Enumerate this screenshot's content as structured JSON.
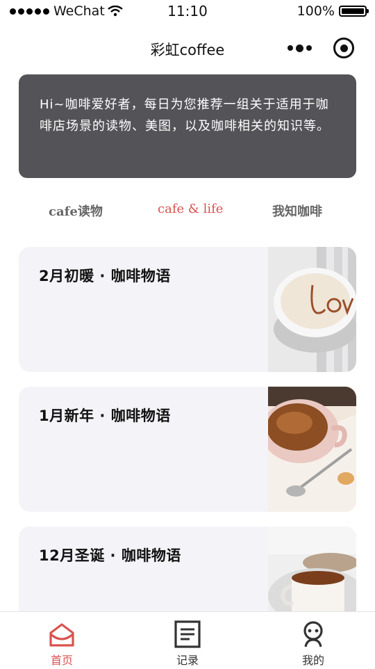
{
  "status_bar": {
    "carrier": "WeChat",
    "time": "11:10",
    "battery": "100%"
  },
  "navbar": {
    "title": "彩虹coffee"
  },
  "banner": {
    "text": "Hi~咖啡爱好者，每日为您推荐一组关于适用于咖啡店场景的读物、美图，以及咖啡相关的知识等。"
  },
  "tabs": [
    {
      "label": "cafe读物",
      "active": false
    },
    {
      "label": "cafe & life",
      "active": true
    },
    {
      "label": "我知咖啡",
      "active": false
    }
  ],
  "articles": [
    {
      "title": "2月初暖 · 咖啡物语",
      "image": "love-latte-art-cup"
    },
    {
      "title": "1月新年 · 咖啡物语",
      "image": "espresso-cup-with-spoon"
    },
    {
      "title": "12月圣诞 · 咖啡物语",
      "image": "coffee-cup-with-pastry"
    }
  ],
  "tabbar": [
    {
      "label": "首页",
      "icon": "home-icon",
      "active": true
    },
    {
      "label": "记录",
      "icon": "document-icon",
      "active": false
    },
    {
      "label": "我的",
      "icon": "profile-icon",
      "active": false
    }
  ],
  "colors": {
    "accent": "#d9534f",
    "banner_bg": "#545458",
    "card_bg": "#f4f4f8"
  }
}
